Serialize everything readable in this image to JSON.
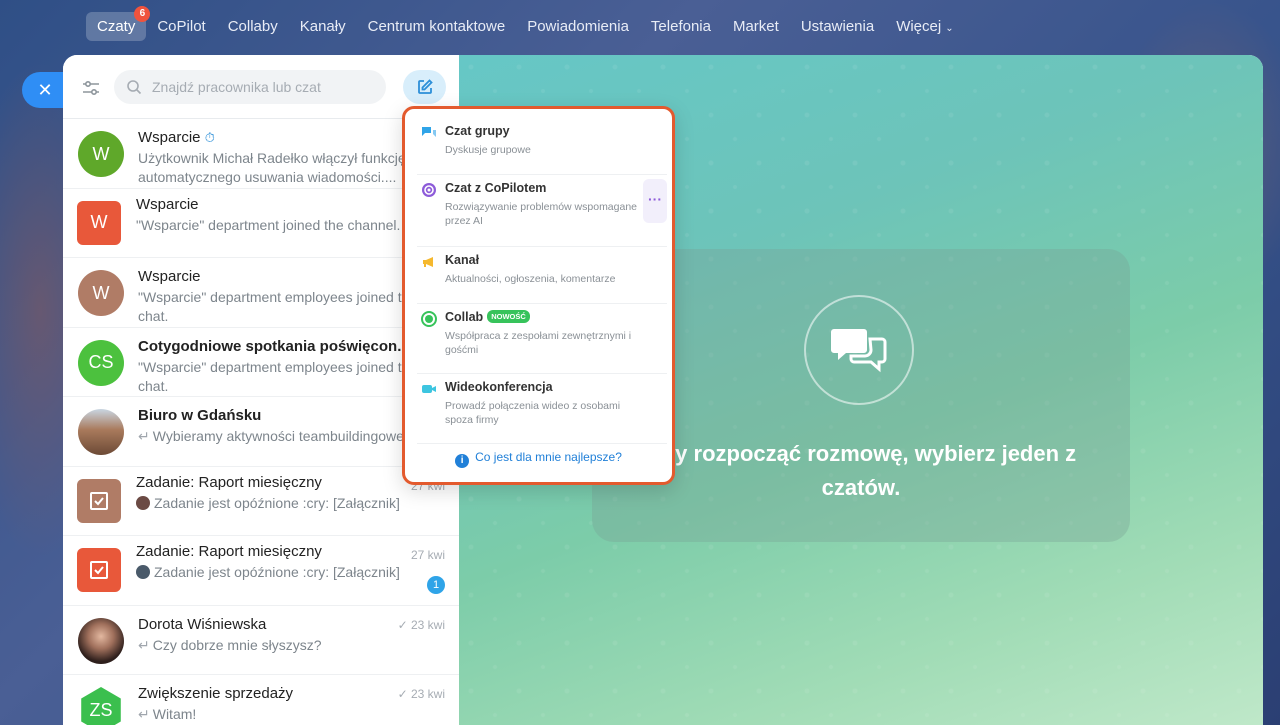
{
  "nav": {
    "items": [
      {
        "label": "Czaty",
        "badge": "6",
        "active": true
      },
      {
        "label": "CoPilot"
      },
      {
        "label": "Collaby"
      },
      {
        "label": "Kanały"
      },
      {
        "label": "Centrum kontaktowe"
      },
      {
        "label": "Powiadomienia"
      },
      {
        "label": "Telefonia"
      },
      {
        "label": "Market"
      },
      {
        "label": "Ustawienia"
      },
      {
        "label": "Więcej"
      }
    ]
  },
  "search": {
    "placeholder": "Znajdź pracownika lub czat"
  },
  "chats": [
    {
      "title": "Wsparcie",
      "message": "Użytkownik Michał Radełko włączył funkcję automatycznego usuwania wiadomości....",
      "avatar": "W",
      "color": "#5fa82a"
    },
    {
      "title": "Wsparcie",
      "message": "\"Wsparcie\" department joined the channel.",
      "avatar": "W",
      "color": "#e8583a"
    },
    {
      "title": "Wsparcie",
      "message": "\"Wsparcie\" department employees joined the chat.",
      "avatar": "W",
      "color": "#b07c66"
    },
    {
      "title": "Cotygodniowe spotkania poświęcon...",
      "message": "\"Wsparcie\" department employees joined the chat.",
      "avatar": "CS",
      "color": "#4cc13e"
    },
    {
      "title": "Biuro w Gdańsku",
      "message": "Wybieramy aktywności teambuildingowe",
      "avatar": "",
      "color": "#8a6a52"
    },
    {
      "title": "Zadanie: Raport miesięczny",
      "message": "Zadanie jest opóźnione :cry: [Załącznik]",
      "date": "27 kwi",
      "color": "#b07c66"
    },
    {
      "title": "Zadanie: Raport miesięczny",
      "message": "Zadanie jest opóźnione :cry: [Załącznik]",
      "date": "27 kwi",
      "unread": "1",
      "color": "#e8583a"
    },
    {
      "title": "Dorota Wiśniewska",
      "message": "Czy dobrze mnie słyszysz?",
      "date": "23 kwi",
      "color": "#5a3c36"
    },
    {
      "title": "Zwiększenie sprzedaży",
      "message": "Witam!",
      "date": "23 kwi",
      "avatar": "ZS",
      "color": "#3bbf4e"
    }
  ],
  "empty": {
    "text": "Aby rozpocząć rozmowę, wybierz jeden z czatów."
  },
  "popup": {
    "items": [
      {
        "title": "Czat grupy",
        "subtitle": "Dyskusje grupowe"
      },
      {
        "title": "Czat z CoPilotem",
        "subtitle": "Rozwiązywanie problemów wspomagane przez AI"
      },
      {
        "title": "Kanał",
        "subtitle": "Aktualności, ogłoszenia, komentarze"
      },
      {
        "title": "Collab",
        "badge": "NOWOŚĆ",
        "subtitle": "Współpraca z zespołami zewnętrznymi i gośćmi"
      },
      {
        "title": "Wideokonferencja",
        "subtitle": "Prowadź połączenia wideo z osobami spoza firmy"
      }
    ],
    "footer": "Co jest dla mnie najlepsze?"
  }
}
